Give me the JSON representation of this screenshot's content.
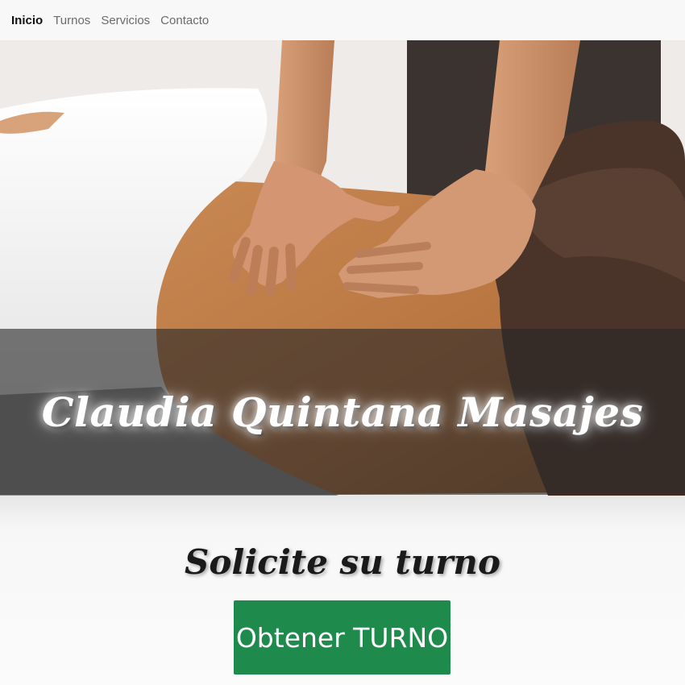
{
  "nav": {
    "items": [
      {
        "label": "Inicio",
        "active": true
      },
      {
        "label": "Turnos",
        "active": false
      },
      {
        "label": "Servicios",
        "active": false
      },
      {
        "label": "Contacto",
        "active": false
      }
    ]
  },
  "hero": {
    "title": "Claudia Quintana Masajes",
    "image": "massage-hands-on-back-photo"
  },
  "cta": {
    "heading": "Solicite su turno",
    "button_label": "Obtener TURNO"
  },
  "colors": {
    "accent": "#1e8a4c",
    "overlay": "#282828"
  }
}
